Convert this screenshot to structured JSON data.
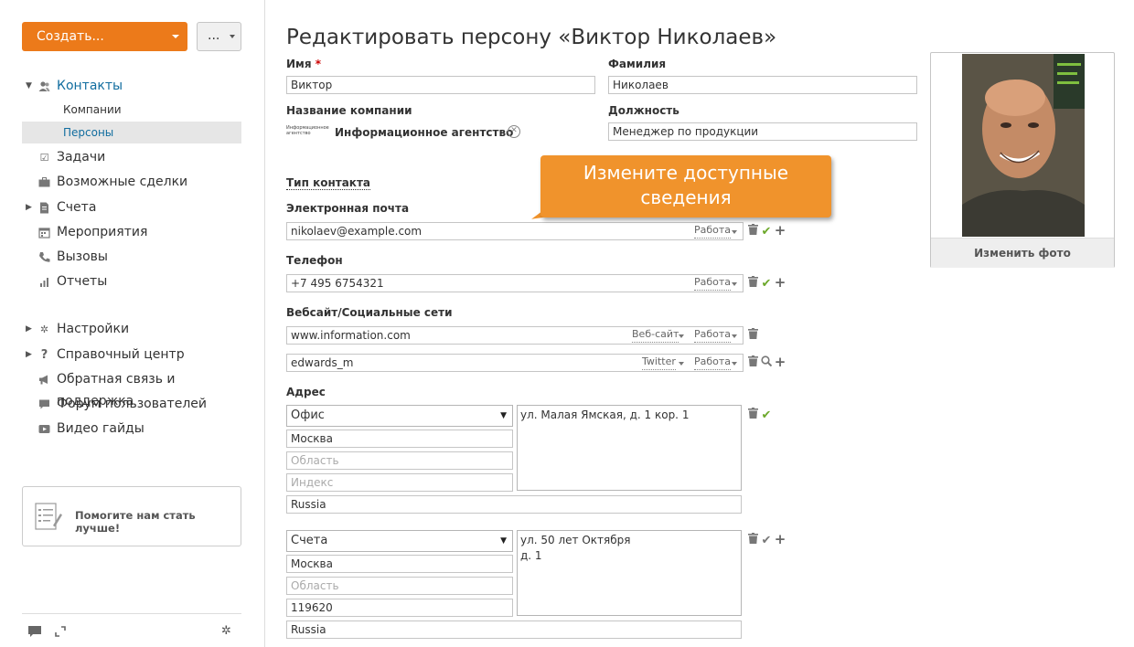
{
  "sidebar": {
    "create_label": "Создать...",
    "more_label": "...",
    "items": [
      {
        "label": "Контакты"
      },
      {
        "label": "Компании"
      },
      {
        "label": "Персоны"
      },
      {
        "label": "Задачи"
      },
      {
        "label": "Возможные сделки"
      },
      {
        "label": "Счета"
      },
      {
        "label": "Мероприятия"
      },
      {
        "label": "Вызовы"
      },
      {
        "label": "Отчеты"
      },
      {
        "label": "Настройки"
      },
      {
        "label": "Справочный центр"
      },
      {
        "label": "Обратная связь и поддержка"
      },
      {
        "label": "Форум пользователей"
      },
      {
        "label": "Видео гайды"
      }
    ],
    "help_text": "Помогите нам стать лучше!"
  },
  "page": {
    "title": "Редактировать персону «Виктор Николаев»"
  },
  "form": {
    "first_name_label": "Имя",
    "required_mark": "*",
    "first_name": "Виктор",
    "last_name_label": "Фамилия",
    "last_name": "Николаев",
    "company_label": "Название компании",
    "company_logo_text": "Информационное агентство",
    "company_name": "Информационное агентство",
    "position_label": "Должность",
    "position": "Менеджер по продукции",
    "contact_type_label": "Тип контакта",
    "email_label": "Электронная почта",
    "email": "nikolaev@example.com",
    "email_category": "Работа",
    "phone_label": "Телефон",
    "phone": "+7 495 6754321",
    "phone_category": "Работа",
    "web_label": "Вебсайт/Социальные сети",
    "web_rows": [
      {
        "value": "www.information.com",
        "type": "Веб-сайт",
        "category": "Работа"
      },
      {
        "value": "edwards_m",
        "type": "Twitter",
        "category": "Работа"
      }
    ],
    "address_label": "Адрес",
    "addresses": [
      {
        "type": "Офис",
        "city": "Москва",
        "region_placeholder": "Область",
        "zip_placeholder": "Индекс",
        "zip": "",
        "country": "Russia",
        "street": "ул. Малая Ямская, д. 1 кор. 1"
      },
      {
        "type": "Счета",
        "city": "Москва",
        "region_placeholder": "Область",
        "zip": "119620",
        "country": "Russia",
        "street": "ул. 50 лет Октября\nд. 1"
      }
    ]
  },
  "tooltip": {
    "text": "Измените доступные сведения"
  },
  "photo": {
    "change_label": "Изменить фото"
  },
  "colors": {
    "accent": "#ec7a1a",
    "tooltip": "#f0932c",
    "link": "#116d9f",
    "check": "#6ca82a"
  }
}
